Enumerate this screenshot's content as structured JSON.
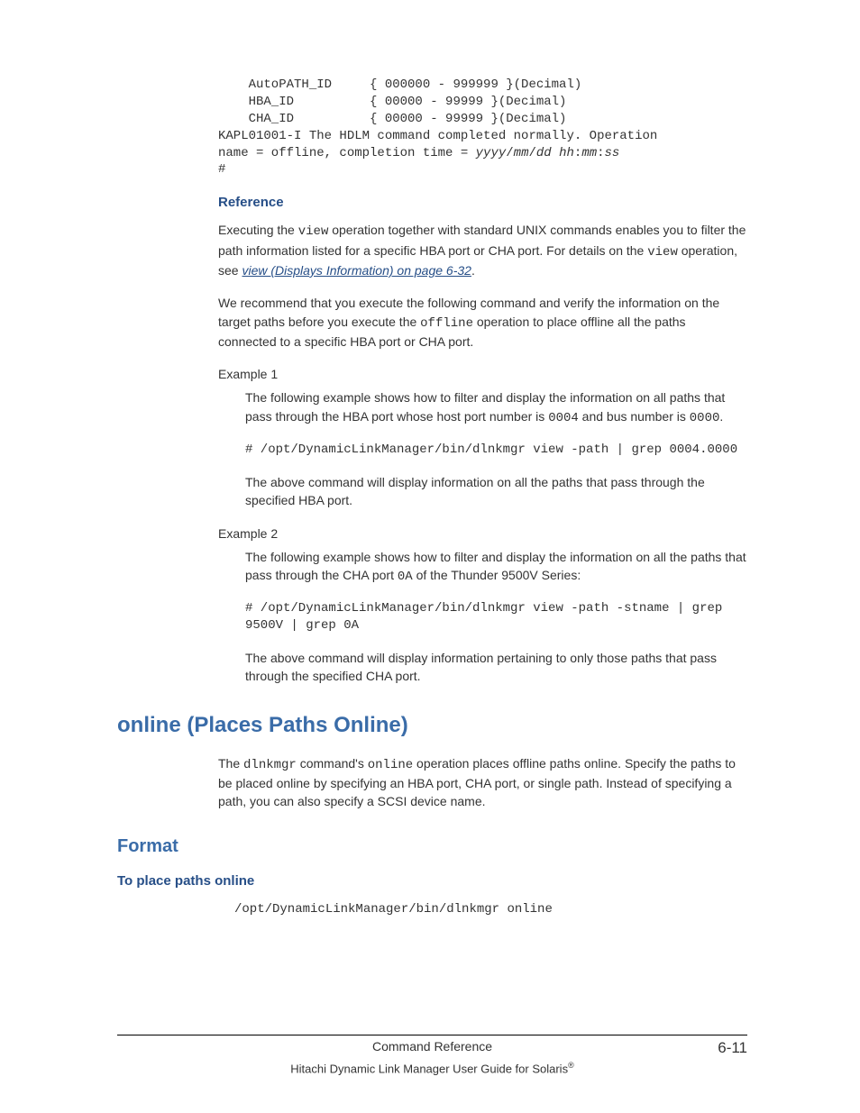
{
  "code1": {
    "l1": "    AutoPATH_ID     { 000000 - 999999 }(Decimal)",
    "l2": "    HBA_ID          { 00000 - 99999 }(Decimal)",
    "l3": "    CHA_ID          { 00000 - 99999 }(Decimal)",
    "l4": "KAPL01001-I The HDLM command completed normally. Operation",
    "l5a": "name = offline, completion time = ",
    "l5b": "yyyy",
    "l5c": "/",
    "l5d": "mm",
    "l5e": "/",
    "l5f": "dd hh",
    "l5g": ":",
    "l5h": "mm",
    "l5i": ":",
    "l5j": "ss",
    "l6": "#"
  },
  "reference": {
    "heading": "Reference",
    "p1a": "Executing the ",
    "p1b": "view",
    "p1c": " operation together with standard UNIX commands enables you to filter the path information listed for a specific HBA port or CHA port. For details on the ",
    "p1d": "view",
    "p1e": " operation, see ",
    "p1link": "view (Displays Information) on page 6-32",
    "p1f": ".",
    "p2a": "We recommend that you execute the following command and verify the information on the target paths before you execute the ",
    "p2b": "offline",
    "p2c": " operation to place offline all the paths connected to a specific HBA port or CHA port.",
    "ex1_label": "Example 1",
    "ex1_p1a": "The following example shows how to filter and display the information on all paths that pass through the HBA port whose host port number is ",
    "ex1_p1b": "0004",
    "ex1_p1c": " and bus number is ",
    "ex1_p1d": "0000",
    "ex1_p1e": ".",
    "ex1_code": "# /opt/DynamicLinkManager/bin/dlnkmgr view -path | grep 0004.0000",
    "ex1_p2": "The above command will display information on all the paths that pass through the specified HBA port.",
    "ex2_label": "Example 2",
    "ex2_p1a": "The following example shows how to filter and display the information on all the paths that pass through the CHA port ",
    "ex2_p1b": "0A",
    "ex2_p1c": " of the Thunder 9500V Series:",
    "ex2_code": "# /opt/DynamicLinkManager/bin/dlnkmgr view -path -stname | grep 9500V | grep 0A",
    "ex2_p2": "The above command will display information pertaining to only those paths that pass through the specified CHA port."
  },
  "online": {
    "h1": "online (Places Paths Online)",
    "p1a": "The ",
    "p1b": "dlnkmgr",
    "p1c": " command's ",
    "p1d": "online",
    "p1e": " operation places offline paths online. Specify the paths to be placed online by specifying an HBA port, CHA port, or single path. Instead of specifying a path, you can also specify a SCSI device name."
  },
  "format": {
    "h2": "Format",
    "h3": "To place paths online",
    "code": "/opt/DynamicLinkManager/bin/dlnkmgr online"
  },
  "footer": {
    "center": "Command Reference",
    "right": "6-11",
    "line2a": "Hitachi Dynamic Link Manager User Guide for Solaris",
    "line2b": "®"
  }
}
